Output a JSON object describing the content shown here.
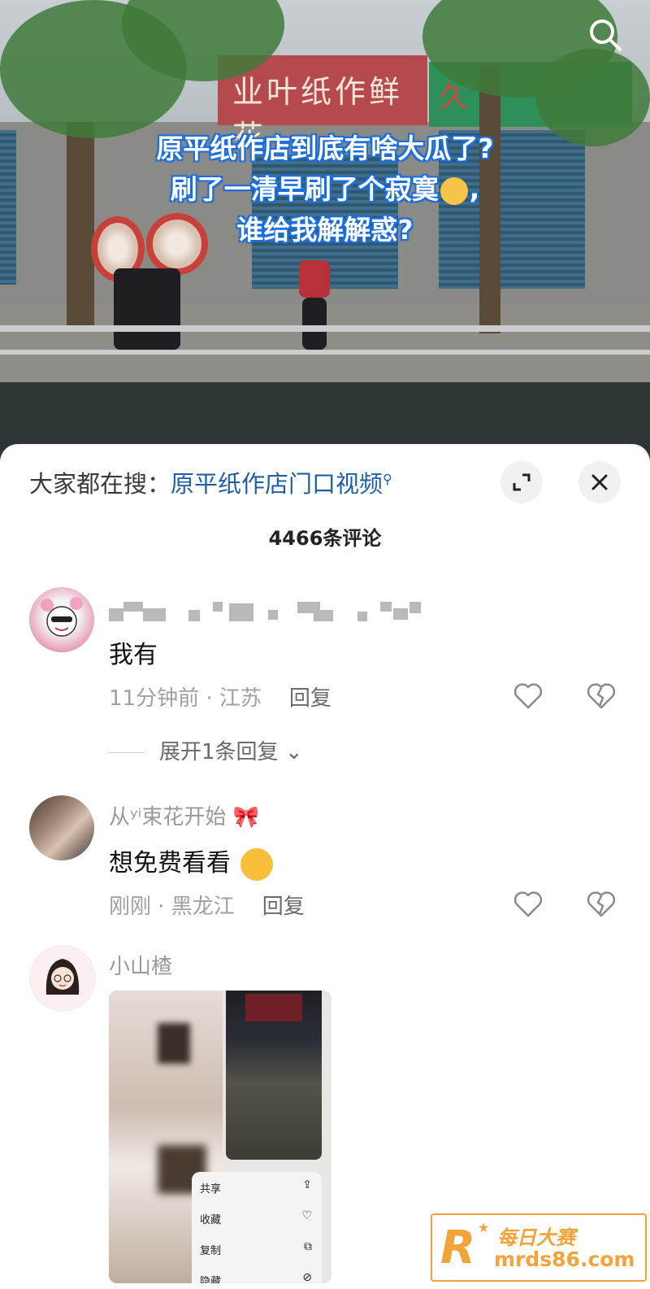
{
  "video": {
    "sign_left": "业叶纸作鲜花",
    "sign_right": "久",
    "overlay_lines": [
      "原平纸作店到底有啥大瓜了?",
      "刷了一清早刷了个寂寞",
      ",",
      "谁给我解解惑?"
    ],
    "search_icon": "search-icon"
  },
  "panel": {
    "hot_search_prefix": "大家都在搜：",
    "hot_search_link": "原平纸作店门口视频",
    "comment_count": "4466条评论",
    "expand_icon": "expand-icon",
    "close_icon": "close-icon"
  },
  "comments": [
    {
      "username": "",
      "text": "我有",
      "time_location": "11分钟前 · 江苏",
      "reply_label": "回复",
      "expand_replies": "展开1条回复"
    },
    {
      "username": "从ʸⁱ束花开始",
      "text": "想免费看看",
      "time_location": "刚刚 · 黑龙江",
      "reply_label": "回复"
    },
    {
      "username": "小山楂",
      "image_menu": [
        "共享",
        "收藏",
        "复制",
        "隐藏"
      ]
    }
  ],
  "watermark": {
    "logo": "R",
    "line1": "每日大赛",
    "line2": "mrds86.com"
  }
}
